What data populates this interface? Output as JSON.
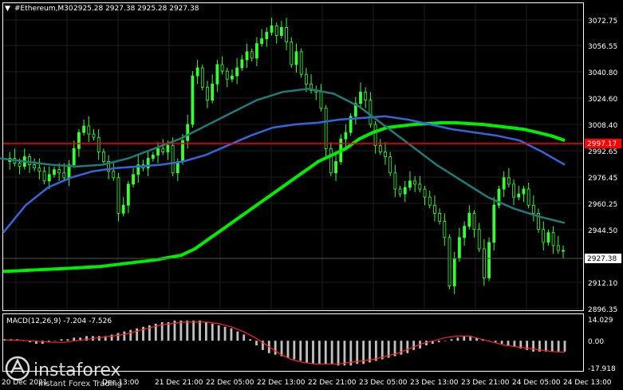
{
  "header": {
    "symbol_text": "#Ethereum,M30",
    "ohlc_text": "2925.28 2927.38 2925.28 2927.38"
  },
  "price_axis": {
    "labels": [
      "3072.75",
      "3056.55",
      "3040.80",
      "3024.60",
      "3008.40",
      "2992.65",
      "2976.45",
      "2960.25",
      "2944.50",
      "2912.10",
      "2896.35"
    ],
    "current_price": "2927.38",
    "level_price": "2997.17",
    "level_color": "#ff0000"
  },
  "time_axis": {
    "labels": [
      "20 Dec 2021",
      "Dec 13:00",
      "21 Dec 21:00",
      "22 Dec 05:00",
      "22 Dec 13:00",
      "22 Dec 21:00",
      "23 Dec 05:00",
      "23 Dec 13:00",
      "23 Dec 21:00",
      "24 Dec 05:00",
      "24 Dec 13:00"
    ]
  },
  "macd": {
    "title": "MACD(12,26,9) -7.204 -7.526",
    "labels": [
      "14.029",
      "0.00",
      "-17.918"
    ]
  },
  "watermark": {
    "brand": "instaforex",
    "tagline": "Instant Forex Trading"
  },
  "chart_data": {
    "type": "line",
    "title": "#Ethereum,M30",
    "ylim": [
      2890,
      3080
    ],
    "macd_ylim": [
      -17.918,
      14.029
    ],
    "price_series": [
      2982,
      2984,
      2981,
      2979,
      2985,
      2980,
      2978,
      2976,
      2970,
      2974,
      2977,
      2975,
      2972,
      2980,
      2990,
      3000,
      3004,
      2999,
      2997,
      2988,
      2982,
      2976,
      2972,
      2950,
      2955,
      2968,
      2974,
      2980,
      2978,
      2984,
      2986,
      2990,
      2988,
      2992,
      2975,
      2982,
      2995,
      3005,
      3035,
      3040,
      3028,
      3020,
      3030,
      3042,
      3038,
      3033,
      3035,
      3040,
      3045,
      3050,
      3046,
      3055,
      3058,
      3062,
      3066,
      3060,
      3065,
      3056,
      3042,
      3050,
      3036,
      3030,
      3026,
      3025,
      3015,
      2990,
      2975,
      2982,
      2996,
      3000,
      3010,
      3018,
      3025,
      3020,
      3005,
      2992,
      2988,
      2985,
      2975,
      2965,
      2962,
      2966,
      2970,
      2968,
      2965,
      2960,
      2955,
      2950,
      2945,
      2935,
      2905,
      2922,
      2935,
      2942,
      2950,
      2940,
      2928,
      2910,
      2932,
      2955,
      2965,
      2972,
      2968,
      2960,
      2962,
      2965,
      2955,
      2950,
      2940,
      2932,
      2938,
      2930,
      2927,
      2927
    ],
    "series": [
      {
        "name": "MA slow",
        "color": "#00ee00",
        "values": [
          2914,
          2914.4,
          2914.8,
          2915.2,
          2915.6,
          2916,
          2916.5,
          2917,
          2918,
          2919,
          2920,
          2921,
          2922.5,
          2924,
          2928,
          2934,
          2940,
          2946,
          2952,
          2958,
          2964,
          2970,
          2976,
          2982,
          2986,
          2990,
          2996,
          3000,
          3003,
          3004,
          3005,
          3005.5,
          3006,
          3006,
          3005.5,
          3005,
          3004,
          3003,
          3002,
          3000,
          2998,
          2995
        ]
      },
      {
        "name": "MA medium",
        "color": "#3366dd",
        "values": [
          2938,
          2955,
          2966,
          2972,
          2976,
          2978,
          2979,
          2980,
          2982,
          2986,
          2992,
          2998,
          3003,
          3005,
          3006,
          3008,
          3009,
          3010,
          3008,
          3005,
          3002,
          3000,
          2998,
          2995,
          2988,
          2980
        ]
      },
      {
        "name": "MA fast",
        "color": "#1f7a7a",
        "values": [
          2984,
          2982,
          2980,
          2979,
          2980,
          2984,
          2990,
          2996,
          3004,
          3012,
          3020,
          3025,
          3027,
          3024,
          3016,
          3004,
          2992,
          2980,
          2970,
          2960,
          2953,
          2948,
          2944
        ]
      }
    ],
    "macd_hist": [
      1,
      1,
      1,
      0,
      -1,
      -2,
      -2,
      -1,
      0,
      1,
      1,
      2,
      2,
      3,
      3,
      3,
      3,
      4,
      5,
      6,
      7,
      8,
      9,
      10,
      11,
      12,
      12,
      13,
      13,
      13,
      13,
      13,
      12,
      11,
      10,
      9,
      8,
      6,
      4,
      1,
      -3,
      -6,
      -8,
      -9,
      -10,
      -11,
      -12,
      -13,
      -14,
      -15,
      -15,
      -15,
      -15,
      -16,
      -16,
      -16,
      -15,
      -15,
      -14,
      -13,
      -12,
      -11,
      -10,
      -9,
      -8,
      -6,
      -5,
      -3,
      -2,
      -1,
      0,
      1,
      2,
      3,
      3,
      2,
      1,
      0,
      -1,
      -2,
      -3,
      -4,
      -5,
      -6,
      -7,
      -7,
      -7,
      -7,
      -7,
      -7
    ],
    "macd_signal": [
      0.5,
      0.5,
      0,
      -0.5,
      -1,
      -1,
      0,
      1,
      2,
      3,
      4,
      6,
      8,
      10,
      11,
      12,
      12,
      12,
      11,
      9,
      6,
      2,
      -3,
      -8,
      -12,
      -14,
      -15,
      -15,
      -15,
      -14,
      -13,
      -12,
      -10,
      -8,
      -5,
      -2,
      0,
      2,
      3,
      3,
      1,
      -1,
      -3,
      -4,
      -5,
      -6,
      -7,
      -7.5
    ]
  }
}
